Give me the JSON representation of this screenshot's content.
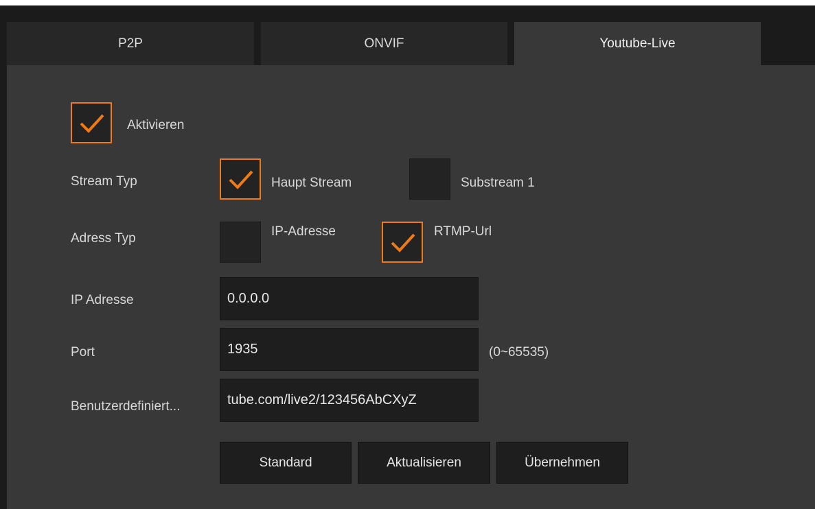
{
  "tabs": [
    {
      "label": "P2P",
      "active": false
    },
    {
      "label": "ONVIF",
      "active": false
    },
    {
      "label": "Youtube-Live",
      "active": true
    }
  ],
  "enable": {
    "label": "Aktivieren",
    "checked": true
  },
  "stream_type": {
    "label": "Stream Typ",
    "options": [
      {
        "label": "Haupt Stream",
        "checked": true
      },
      {
        "label": "Substream 1",
        "checked": false
      }
    ]
  },
  "address_type": {
    "label": "Adress Typ",
    "options": [
      {
        "label": "IP-Adresse",
        "checked": false
      },
      {
        "label": "RTMP-Url",
        "checked": true
      }
    ]
  },
  "ip_address": {
    "label": "IP Adresse",
    "value": "0.0.0.0"
  },
  "port": {
    "label": "Port",
    "value": "1935",
    "range_hint": "(0~65535)"
  },
  "custom_url": {
    "label": "Benutzerdefiniert...",
    "value": "tube.com/live2/123456AbCXyZ"
  },
  "buttons": {
    "default": "Standard",
    "refresh": "Aktualisieren",
    "apply": "Übernehmen"
  },
  "colors": {
    "accent": "#f07a14",
    "panel": "#383838",
    "field": "#1e1e1e"
  }
}
